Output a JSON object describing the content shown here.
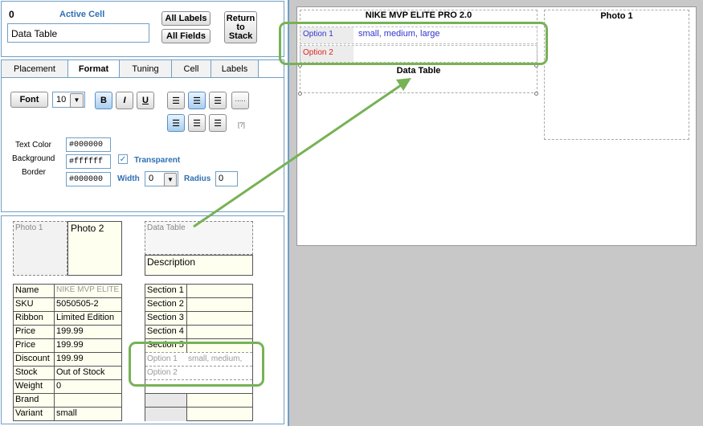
{
  "cell_header": {
    "index": "0",
    "title": "Active Cell",
    "value": "Data Table"
  },
  "buttons": {
    "all_labels": "All Labels",
    "all_fields": "All Fields",
    "return_to_stack": "Return to Stack"
  },
  "tabs": [
    "Placement",
    "Format",
    "Tuning",
    "Cell",
    "Labels"
  ],
  "format": {
    "font_label": "Font",
    "font_size": "10",
    "bold": "B",
    "italic": "I",
    "underline": "U",
    "help": "[?]",
    "text_color_label": "Text Color",
    "text_color": "#000000",
    "background_label": "Background",
    "background": "#ffffff",
    "transparent_label": "Transparent",
    "border_label": "Border",
    "border": "#000000",
    "width_label": "Width",
    "width": "0",
    "radius_label": "Radius",
    "radius": "0"
  },
  "layout": {
    "photo1": "Photo 1",
    "photo2": "Photo 2",
    "data_table": "Data Table",
    "description": "Description",
    "fields": [
      {
        "label": "Name",
        "value": "NIKE MVP ELITE"
      },
      {
        "label": "SKU",
        "value": "5050505-2"
      },
      {
        "label": "Ribbon",
        "value": "Limited Edition"
      },
      {
        "label": "Price",
        "value": "199.99"
      },
      {
        "label": "Price",
        "value": "199.99"
      },
      {
        "label": "Discount",
        "value": "199.99"
      },
      {
        "label": "Stock",
        "value": "Out of Stock"
      },
      {
        "label": "Weight",
        "value": "0"
      },
      {
        "label": "Brand",
        "value": ""
      },
      {
        "label": "Variant",
        "value": "small"
      }
    ],
    "sections": [
      "Section 1",
      "Section 2",
      "Section 3",
      "Section 4",
      "Section 5"
    ],
    "options": [
      {
        "label": "Option 1",
        "value": "small, medium,"
      },
      {
        "label": "Option 2",
        "value": ""
      }
    ]
  },
  "preview": {
    "title": "NIKE MVP ELITE PRO 2.0",
    "photo": "Photo 1",
    "options": [
      {
        "label": "Option 1",
        "value": "small, medium, large"
      },
      {
        "label": "Option 2",
        "value": ""
      }
    ],
    "data_table_label": "Data Table"
  },
  "colors": {
    "accent": "#6f9fc6",
    "highlight": "#77b255",
    "option1": "#3333cc",
    "option2": "#dd2222",
    "preview_bg": "#c8c8c8"
  }
}
